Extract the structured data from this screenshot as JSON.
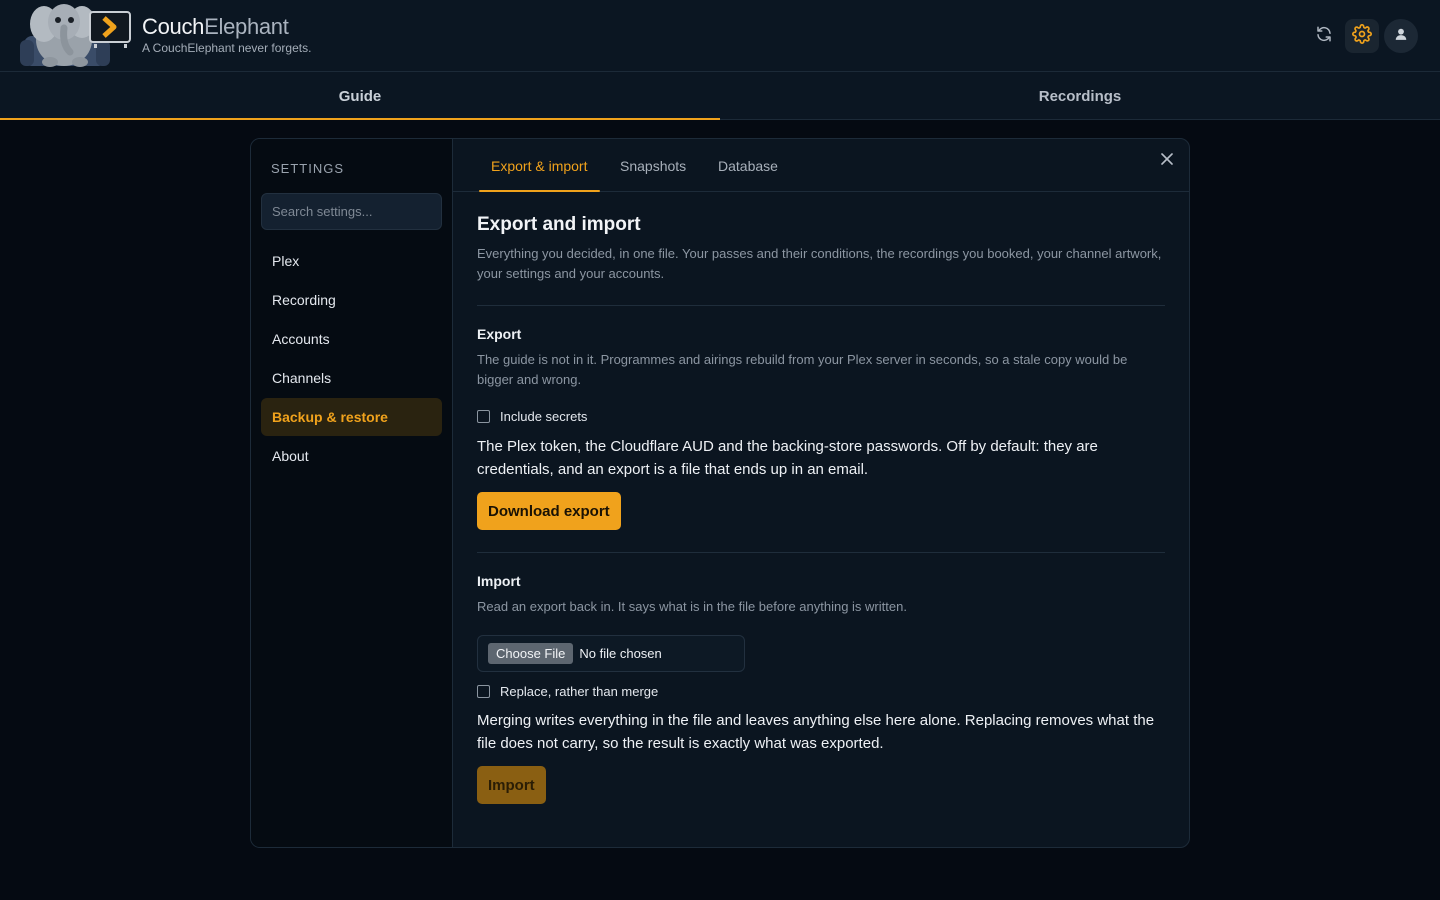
{
  "app": {
    "name_part1": "Couch",
    "name_part2": "Elephant",
    "tagline": "A CouchElephant never forgets.",
    "accent": "#f0a21c"
  },
  "header": {
    "icons": [
      "refresh-icon",
      "gear-icon",
      "user-icon"
    ]
  },
  "nav": {
    "tabs": [
      {
        "label": "Guide",
        "active": true
      },
      {
        "label": "Recordings",
        "active": false
      }
    ]
  },
  "settings": {
    "title": "SETTINGS",
    "search_placeholder": "Search settings...",
    "items": [
      {
        "label": "Plex"
      },
      {
        "label": "Recording"
      },
      {
        "label": "Accounts"
      },
      {
        "label": "Channels"
      },
      {
        "label": "Backup & restore",
        "active": true
      },
      {
        "label": "About"
      }
    ]
  },
  "tabs": [
    {
      "label": "Export & import",
      "active": true
    },
    {
      "label": "Snapshots"
    },
    {
      "label": "Database"
    }
  ],
  "page": {
    "title": "Export and import",
    "description": "Everything you decided, in one file. Your passes and their conditions, the recordings you booked, your channel artwork, your settings and your accounts."
  },
  "export": {
    "heading": "Export",
    "description": "The guide is not in it. Programmes and airings rebuild from your Plex server in seconds, so a stale copy would be bigger and wrong.",
    "checkbox_label": "Include secrets",
    "checkbox_checked": false,
    "note": "The Plex token, the Cloudflare AUD and the backing-store passwords. Off by default: they are credentials, and an export is a file that ends up in an email.",
    "button": "Download export"
  },
  "import": {
    "heading": "Import",
    "description": "Read an export back in. It says what is in the file before anything is written.",
    "file_button": "Choose File",
    "file_status": "No file chosen",
    "checkbox_label": "Replace, rather than merge",
    "checkbox_checked": false,
    "note": "Merging writes everything in the file and leaves anything else here alone. Replacing removes what the file does not carry, so the result is exactly what was exported.",
    "button": "Import"
  }
}
